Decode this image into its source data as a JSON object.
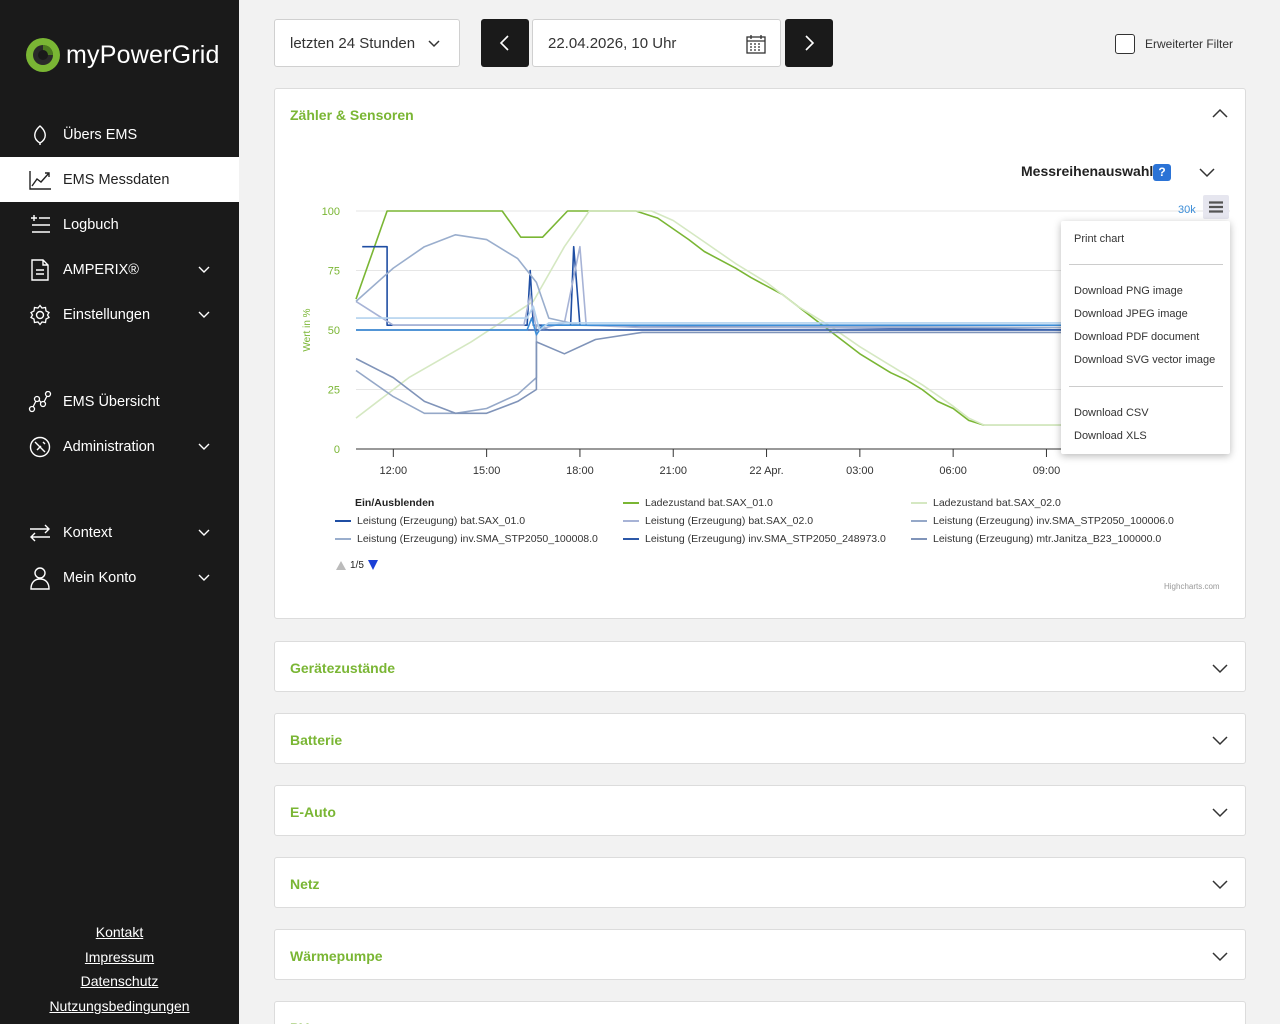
{
  "brand": {
    "name": "myPowerGrid"
  },
  "sidebar": {
    "items": [
      {
        "label": "Übers EMS",
        "icon": "leaf-icon",
        "has_chevron": false,
        "active": false
      },
      {
        "label": "EMS Messdaten",
        "icon": "line-chart-icon",
        "has_chevron": false,
        "active": true
      },
      {
        "label": "Logbuch",
        "icon": "list-add-icon",
        "has_chevron": false,
        "active": false
      },
      {
        "label": "AMPERIX®",
        "icon": "document-icon",
        "has_chevron": true,
        "active": false
      },
      {
        "label": "Einstellungen",
        "icon": "gear-icon",
        "has_chevron": true,
        "active": false
      },
      {
        "label": "EMS Übersicht",
        "icon": "network-icon",
        "has_chevron": false,
        "active": false
      },
      {
        "label": "Administration",
        "icon": "admin-icon",
        "has_chevron": true,
        "active": false
      },
      {
        "label": "Kontext",
        "icon": "swap-arrows-icon",
        "has_chevron": true,
        "active": false
      },
      {
        "label": "Mein Konto",
        "icon": "user-icon",
        "has_chevron": true,
        "active": false
      }
    ],
    "footer": [
      "Kontakt",
      "Impressum",
      "Datenschutz",
      "Nutzungsbedingungen"
    ]
  },
  "toolbar": {
    "range_value": "letzten 24 Stunden",
    "date_value": "22.04.2026, 10 Uhr",
    "filter_label": "Erweiterter Filter",
    "filter_checked": false
  },
  "panels": {
    "sensors": {
      "title": "Zähler & Sensoren",
      "expanded": true
    },
    "collapsed": [
      "Gerätezustände",
      "Batterie",
      "E-Auto",
      "Netz",
      "Wärmepumpe",
      "PV"
    ]
  },
  "chart_section": {
    "series_select_label": "Messreihenauswahl",
    "help_label": "?",
    "legend_title": "Ein/Ausblenden",
    "pager": "1/5",
    "credits": "Highcharts.com",
    "right_axis_label": "30k"
  },
  "export_menu": {
    "items": [
      "Print chart",
      "Download PNG image",
      "Download JPEG image",
      "Download PDF document",
      "Download SVG vector image",
      "Download CSV",
      "Download XLS"
    ]
  },
  "colors": {
    "accent_green": "#7ab634",
    "sidebar_bg": "#1a1a1a",
    "help_blue": "#2b73d6"
  },
  "chart_data": {
    "type": "line",
    "ylabel": "Wert in %",
    "ylim": [
      0,
      100
    ],
    "yticks": [
      0,
      25,
      50,
      75,
      100
    ],
    "xtick_labels": [
      "12:00",
      "15:00",
      "18:00",
      "21:00",
      "22 Apr.",
      "03:00",
      "06:00",
      "09:00"
    ],
    "xlim_hours": [
      10.8,
      35.0
    ],
    "xticks_hours": [
      12,
      15,
      18,
      21,
      24,
      27,
      30,
      33
    ],
    "legend_placement": "bottom",
    "series": [
      {
        "name": "Ladezustand bat.SAX_01.0",
        "color": "#7ab634",
        "width": 1.6,
        "points": [
          [
            10.8,
            63
          ],
          [
            11.8,
            100
          ],
          [
            15.5,
            100
          ],
          [
            16.1,
            89
          ],
          [
            16.8,
            89
          ],
          [
            17.6,
            100
          ],
          [
            19.8,
            100
          ],
          [
            20.5,
            97
          ],
          [
            21.5,
            88
          ],
          [
            22.0,
            83
          ],
          [
            23.0,
            76
          ],
          [
            23.5,
            72
          ],
          [
            24.5,
            65
          ],
          [
            25.5,
            55
          ],
          [
            26.0,
            50
          ],
          [
            26.5,
            45
          ],
          [
            27.0,
            40
          ],
          [
            28.0,
            32
          ],
          [
            28.5,
            29
          ],
          [
            29.0,
            25
          ],
          [
            29.5,
            20
          ],
          [
            30.0,
            17
          ],
          [
            30.5,
            12
          ],
          [
            31.0,
            10
          ],
          [
            34.0,
            10
          ]
        ]
      },
      {
        "name": "Ladezustand bat.SAX_02.0",
        "color": "#d5e8c2",
        "width": 1.6,
        "points": [
          [
            10.8,
            13
          ],
          [
            12.5,
            30
          ],
          [
            14.5,
            45
          ],
          [
            16.5,
            62
          ],
          [
            17.5,
            85
          ],
          [
            18.3,
            100
          ],
          [
            20.3,
            100
          ],
          [
            21.0,
            96
          ],
          [
            22.0,
            87
          ],
          [
            23.0,
            78
          ],
          [
            24.0,
            70
          ],
          [
            25.0,
            60
          ],
          [
            26.0,
            52
          ],
          [
            27.0,
            43
          ],
          [
            28.0,
            35
          ],
          [
            29.0,
            27
          ],
          [
            30.0,
            18
          ],
          [
            30.5,
            13
          ],
          [
            31.0,
            10
          ],
          [
            34.0,
            10
          ]
        ]
      },
      {
        "name": "Leistung (Erzeugung) bat.SAX_01.0",
        "color": "#1f4ea3",
        "width": 1.6,
        "points": [
          [
            11.0,
            85
          ],
          [
            11.8,
            85
          ],
          [
            11.8,
            52
          ],
          [
            16.3,
            52
          ],
          [
            16.4,
            75
          ],
          [
            16.5,
            52
          ],
          [
            17.7,
            52
          ],
          [
            17.8,
            85
          ],
          [
            18.0,
            52
          ],
          [
            34.0,
            50
          ]
        ]
      },
      {
        "name": "Leistung (Erzeugung) bat.SAX_02.0",
        "color": "#a7b3d6",
        "width": 1.6,
        "points": [
          [
            10.8,
            62
          ],
          [
            12.0,
            52
          ],
          [
            16.2,
            52
          ],
          [
            16.4,
            65
          ],
          [
            16.6,
            50
          ],
          [
            17.5,
            53
          ],
          [
            18.0,
            85
          ],
          [
            18.2,
            52
          ],
          [
            20.0,
            51
          ],
          [
            34.0,
            51
          ]
        ]
      },
      {
        "name": "Leistung (Erzeugung) inv.SMA_STP2050_100006.0",
        "color": "#95a8c8",
        "width": 1.6,
        "points": [
          [
            10.8,
            33
          ],
          [
            12.0,
            22
          ],
          [
            13.0,
            15
          ],
          [
            14.0,
            15
          ],
          [
            15.0,
            17
          ],
          [
            16.0,
            23
          ],
          [
            16.6,
            30
          ],
          [
            16.6,
            52
          ],
          [
            17.0,
            50
          ],
          [
            34.0,
            50
          ]
        ]
      },
      {
        "name": "Leistung (Erzeugung) inv.SMA_STP2050_100008.0",
        "color": "#9aaecd",
        "width": 1.6,
        "points": [
          [
            10.8,
            62
          ],
          [
            12.0,
            76
          ],
          [
            13.0,
            85
          ],
          [
            14.0,
            90
          ],
          [
            15.0,
            88
          ],
          [
            16.0,
            80
          ],
          [
            16.6,
            70
          ],
          [
            17.0,
            55
          ],
          [
            18.0,
            52
          ],
          [
            34.0,
            51
          ]
        ]
      },
      {
        "name": "Leistung (Erzeugung) inv.SMA_STP2050_248973.0",
        "color": "#2c58a8",
        "width": 1.6,
        "points": [
          [
            10.8,
            50
          ],
          [
            34.0,
            50
          ]
        ]
      },
      {
        "name": "Leistung (Erzeugung) mtr.Janitza_B23_100000.0",
        "color": "#8094b9",
        "width": 1.6,
        "points": [
          [
            10.8,
            38
          ],
          [
            12.0,
            30
          ],
          [
            13.0,
            20
          ],
          [
            14.0,
            15
          ],
          [
            15.0,
            15
          ],
          [
            16.0,
            20
          ],
          [
            16.6,
            25
          ],
          [
            16.6,
            45
          ],
          [
            17.5,
            40
          ],
          [
            18.5,
            46
          ],
          [
            20.0,
            49
          ],
          [
            34.0,
            49
          ]
        ]
      },
      {
        "name": "",
        "color": "#3d8ed8",
        "width": 1.6,
        "points": [
          [
            10.8,
            50
          ],
          [
            16.3,
            50
          ],
          [
            16.45,
            55
          ],
          [
            16.6,
            48
          ],
          [
            16.8,
            52
          ],
          [
            20.0,
            52
          ],
          [
            21.0,
            52
          ],
          [
            24.0,
            52
          ],
          [
            27.0,
            52
          ],
          [
            30.0,
            52
          ],
          [
            34.0,
            52
          ]
        ]
      },
      {
        "name": "",
        "color": "#b4d2ee",
        "width": 1.6,
        "points": [
          [
            10.8,
            55
          ],
          [
            16.3,
            55
          ],
          [
            16.5,
            60
          ],
          [
            16.7,
            50
          ],
          [
            17.0,
            53
          ],
          [
            34.0,
            53
          ]
        ]
      }
    ]
  }
}
